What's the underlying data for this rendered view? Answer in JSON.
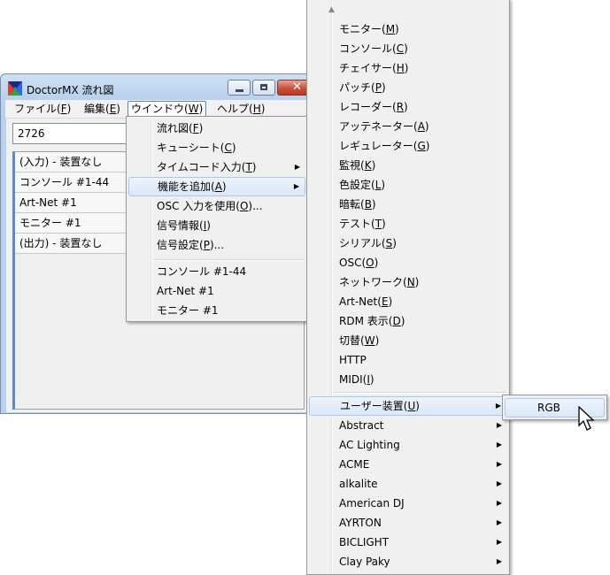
{
  "window": {
    "title": "DoctorMX 流れ図",
    "colors": {
      "titlebar": "#b9d1ec",
      "close": "#c8523d"
    }
  },
  "menubar": [
    {
      "label": "ファイル(",
      "key": "F",
      "end": ")"
    },
    {
      "label": "編集(",
      "key": "E",
      "end": ")"
    },
    {
      "label": "ウインドウ(",
      "key": "W",
      "end": ")"
    },
    {
      "label": "ヘルプ(",
      "key": "H",
      "end": ")"
    }
  ],
  "input": {
    "value": "2726"
  },
  "list": [
    "(入力) - 装置なし",
    "コンソール #1-44",
    "Art-Net #1",
    "モニター #1",
    "(出力) - 装置なし"
  ],
  "window_menu": [
    {
      "label": "流れ図(",
      "key": "F",
      "end": ")"
    },
    {
      "label": "キューシート(",
      "key": "C",
      "end": ")"
    },
    {
      "label": "タイムコード入力(",
      "key": "T",
      "end": ")"
    },
    {
      "label": "機能を追加(",
      "key": "A",
      "end": ")"
    },
    {
      "label": "OSC 入力を使用(",
      "key": "O",
      "end": ")..."
    },
    {
      "label": "信号情報(",
      "key": "I",
      "end": ")"
    },
    {
      "label": "信号設定(",
      "key": "P",
      "end": ")..."
    },
    {
      "label": "コンソール #1-44",
      "key": "",
      "end": ""
    },
    {
      "label": "Art-Net #1",
      "key": "",
      "end": ""
    },
    {
      "label": "モニター #1",
      "key": "",
      "end": ""
    }
  ],
  "functions_menu": [
    {
      "label": "モニター(",
      "key": "M",
      "end": ")"
    },
    {
      "label": "コンソール(",
      "key": "C",
      "end": ")"
    },
    {
      "label": "チェイサー(",
      "key": "H",
      "end": ")"
    },
    {
      "label": "パッチ(",
      "key": "P",
      "end": ")"
    },
    {
      "label": "レコーダー(",
      "key": "R",
      "end": ")"
    },
    {
      "label": "アッテネーター(",
      "key": "A",
      "end": ")"
    },
    {
      "label": "レギュレーター(",
      "key": "G",
      "end": ")"
    },
    {
      "label": "監視(",
      "key": "K",
      "end": ")"
    },
    {
      "label": "色設定(",
      "key": "L",
      "end": ")"
    },
    {
      "label": "暗転(",
      "key": "B",
      "end": ")"
    },
    {
      "label": "テスト(",
      "key": "T",
      "end": ")"
    },
    {
      "label": "シリアル(",
      "key": "S",
      "end": ")"
    },
    {
      "label": "OSC(",
      "key": "O",
      "end": ")"
    },
    {
      "label": "ネットワーク(",
      "key": "N",
      "end": ")"
    },
    {
      "label": "Art-Net(",
      "key": "E",
      "end": ")"
    },
    {
      "label": "RDM 表示(",
      "key": "D",
      "end": ")"
    },
    {
      "label": "切替(",
      "key": "W",
      "end": ")"
    },
    {
      "label": "HTTP",
      "key": "",
      "end": ""
    },
    {
      "label": "MIDI(",
      "key": "I",
      "end": ")"
    },
    {
      "label": "ユーザー装置(",
      "key": "U",
      "end": ")"
    },
    {
      "label": "Abstract",
      "key": "",
      "end": ""
    },
    {
      "label": "AC Lighting",
      "key": "",
      "end": ""
    },
    {
      "label": "ACME",
      "key": "",
      "end": ""
    },
    {
      "label": "alkalite",
      "key": "",
      "end": ""
    },
    {
      "label": "American DJ",
      "key": "",
      "end": ""
    },
    {
      "label": "AYRTON",
      "key": "",
      "end": ""
    },
    {
      "label": "BICLIGHT",
      "key": "",
      "end": ""
    },
    {
      "label": "Clay Paky",
      "key": "",
      "end": ""
    }
  ],
  "user_menu": [
    {
      "label": "RGB"
    }
  ],
  "icons": {
    "app": "doctormx-app-icon",
    "submenu": "chevron-right-icon",
    "scroll": "scroll-up-arrow-icon",
    "cursor": "mouse-pointer-icon"
  }
}
